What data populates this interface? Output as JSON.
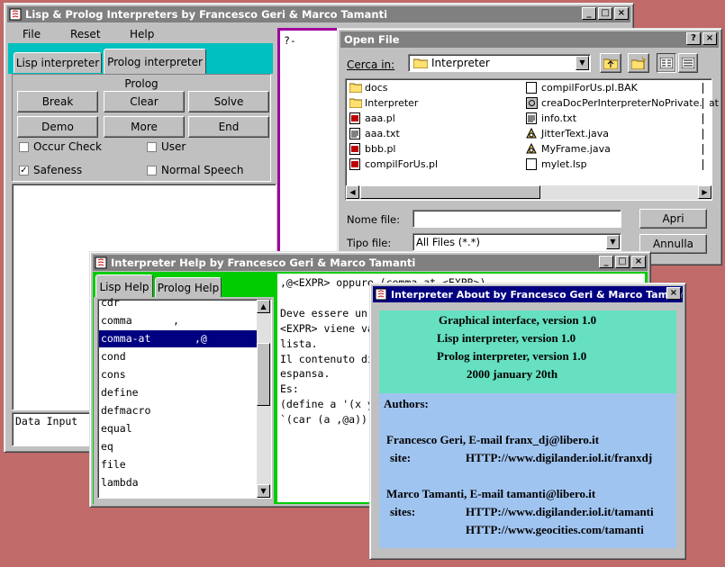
{
  "main_window": {
    "title": "Lisp & Prolog Interpreters by Francesco Geri & Marco Tamanti",
    "menu": [
      "File",
      "Reset",
      "Help"
    ],
    "tabs": [
      "Lisp interpreter",
      "Prolog interpreter"
    ],
    "group_label": "Prolog",
    "buttons": [
      "Break",
      "Clear",
      "Solve",
      "Demo",
      "More",
      "End"
    ],
    "checkboxes": [
      {
        "label": "Occur Check",
        "checked": false
      },
      {
        "label": "User",
        "checked": false
      },
      {
        "label": "Safeness",
        "checked": true
      },
      {
        "label": "Normal Speech",
        "checked": false
      }
    ],
    "data_input_label": "Data Input",
    "console_prompt": "?-"
  },
  "open_file": {
    "title": "Open File",
    "look_in_label": "Cerca in:",
    "look_in_value": "Interpreter",
    "files": [
      {
        "name": "docs",
        "icon": "folder-icon"
      },
      {
        "name": "Interpreter",
        "icon": "folder-icon"
      },
      {
        "name": "aaa.pl",
        "icon": "pl-file-icon"
      },
      {
        "name": "aaa.txt",
        "icon": "text-file-icon"
      },
      {
        "name": "bbb.pl",
        "icon": "pl-file-icon"
      },
      {
        "name": "compilForUs.pl",
        "icon": "pl-file-icon"
      },
      {
        "name": "compilForUs.pl.BAK",
        "icon": "file-icon"
      },
      {
        "name": "creaDocPerInterpreterNoPrivate.bat",
        "icon": "bat-file-icon"
      },
      {
        "name": "info.txt",
        "icon": "text-file-icon"
      },
      {
        "name": "JitterText.java",
        "icon": "java-file-icon"
      },
      {
        "name": "MyFrame.java",
        "icon": "java-file-icon"
      },
      {
        "name": "mylet.lsp",
        "icon": "file-icon"
      }
    ],
    "filename_label": "Nome file:",
    "filename_value": "",
    "filetype_label": "Tipo file:",
    "filetype_value": "All Files (*.*)",
    "open_button": "Apri",
    "cancel_button": "Annulla"
  },
  "help_window": {
    "title": "Interpreter Help by Francesco Geri & Marco Tamanti",
    "tabs": [
      "Lisp Help",
      "Prolog Help"
    ],
    "items": [
      {
        "name": "cdr",
        "sym": ""
      },
      {
        "name": "comma",
        "sym": ","
      },
      {
        "name": "comma-at",
        "sym": ",@"
      },
      {
        "name": "cond",
        "sym": ""
      },
      {
        "name": "cons",
        "sym": ""
      },
      {
        "name": "define",
        "sym": ""
      },
      {
        "name": "defmacro",
        "sym": ""
      },
      {
        "name": "equal",
        "sym": ""
      },
      {
        "name": "eq",
        "sym": ""
      },
      {
        "name": "file",
        "sym": ""
      },
      {
        "name": "lambda",
        "sym": ""
      }
    ],
    "selected_index": 2,
    "text_lines": [
      ",@<EXPR> oppure (comma-at <EXPR>)",
      "",
      "Deve essere un",
      "<EXPR> viene va",
      "lista.",
      "Il contenuto di",
      "espansa.",
      "Es:",
      "(define a '(x y",
      "`(car (a ,@a))"
    ]
  },
  "about_window": {
    "title": "Interpreter About by Francesco Geri & Marco Tamanti",
    "versions": [
      "Graphical interface, version 1.0",
      "Lisp interpreter, version 1.0",
      "Prolog interpreter, version 1.0",
      "2000 january 20th"
    ],
    "authors_label": "Authors:",
    "author1": "Francesco Geri, E-mail franx_dj@libero.it",
    "author1_site_label": "site:",
    "author1_site": "HTTP://www.digilander.iol.it/franxdj",
    "author2": "Marco Tamanti, E-mail tamanti@libero.it",
    "author2_site_label": "sites:",
    "author2_site1": "HTTP://www.digilander.iol.it/tamanti",
    "author2_site2": "HTTP://www.geocities.com/tamanti"
  },
  "colors": {
    "desktop": "#c06a6a",
    "active_title": "#000080",
    "inactive_title": "#808080",
    "tab_strip": "#00c0c0",
    "help_strip": "#00cc00",
    "console_border": "#a000a0",
    "about_top": "#66e0c0",
    "about_bottom": "#a0c4f0"
  }
}
